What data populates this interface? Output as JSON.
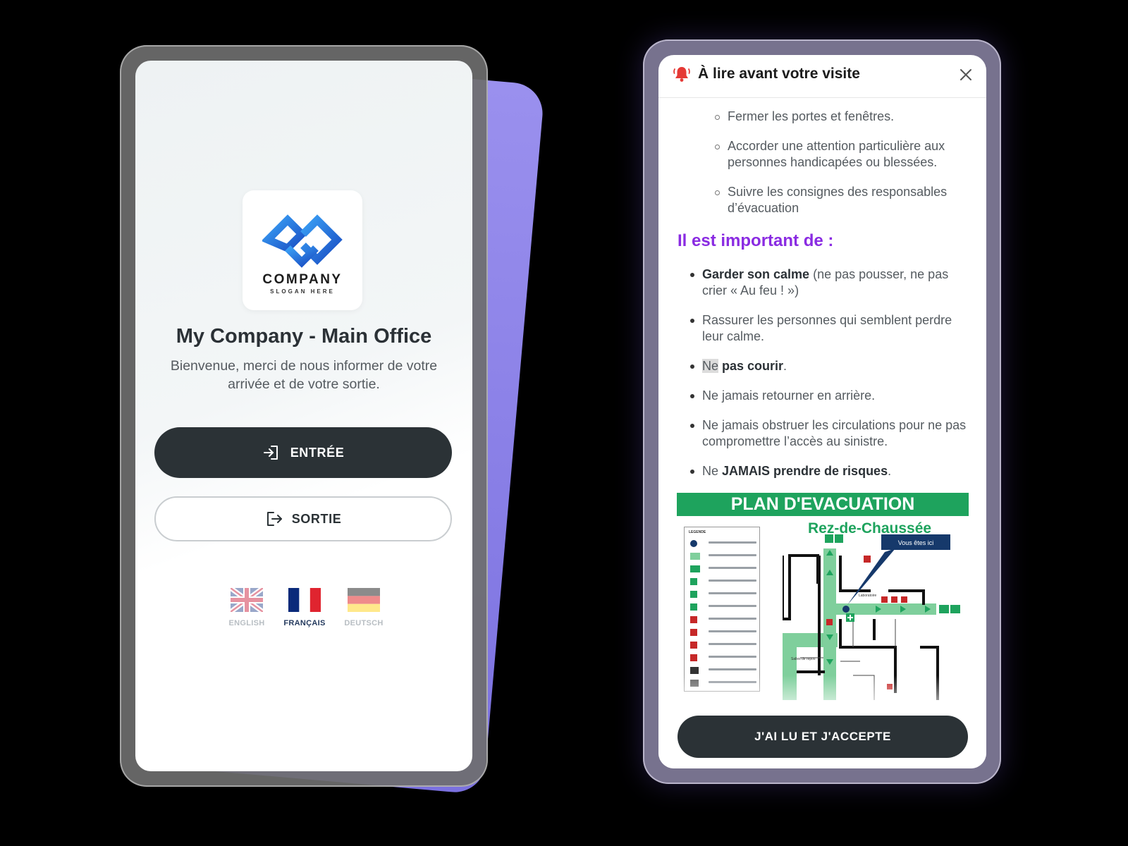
{
  "signin_screen": {
    "logo": {
      "name": "COMPANY",
      "slogan": "SLOGAN HERE",
      "brand_color": "#1f6fd6"
    },
    "title": "My Company - Main Office",
    "welcome": "Bienvenue, merci de nous informer de votre arrivée et de votre sortie.",
    "entry_button": {
      "label": "ENTRÉE",
      "icon": "login-icon"
    },
    "exit_button": {
      "label": "SORTIE",
      "icon": "logout-icon"
    },
    "languages": [
      {
        "label": "ENGLISH",
        "flag": "uk-flag-icon",
        "selected": false
      },
      {
        "label": "FRANÇAIS",
        "flag": "france-flag-icon",
        "selected": true
      },
      {
        "label": "DEUTSCH",
        "flag": "germany-flag-icon",
        "selected": false
      }
    ]
  },
  "visit_modal": {
    "title": "À lire avant votre visite",
    "header_icon": "alarm-bell-icon",
    "close_icon": "close-icon",
    "sub_items": [
      "Fermer les portes et fenêtres.",
      "Accorder une attention particulière aux personnes handicapées ou blessées.",
      "Suivre les consignes des responsables d’évacuation"
    ],
    "important_heading": "Il est important de :",
    "rules": {
      "r1_bold": "Garder son calme",
      "r1_rest": " (ne pas pousser, ne pas crier « Au feu ! »)",
      "r2": "Rassurer les personnes qui semblent perdre leur calme.",
      "r3_hl": "Ne",
      "r3_bold": " pas courir",
      "r3_end": ".",
      "r4": "Ne jamais retourner en arrière.",
      "r5": "Ne jamais obstruer les circulations pour ne pas compromettre l’accès au sinistre.",
      "r6_start": "Ne ",
      "r6_bold": "JAMAIS prendre de risques",
      "r6_end": "."
    },
    "plan": {
      "title": "PLAN D'EVACUATION",
      "subtitle": "Rez-de-Chaussée",
      "legend_title": "LEGENDE",
      "you_are_here": "Vous êtes ici",
      "room_lab": "Laboratoire",
      "room_rest": "Salles de repos",
      "accent": "#1ea35d"
    },
    "accept_button": "J'AI LU ET J'ACCEPTE"
  }
}
